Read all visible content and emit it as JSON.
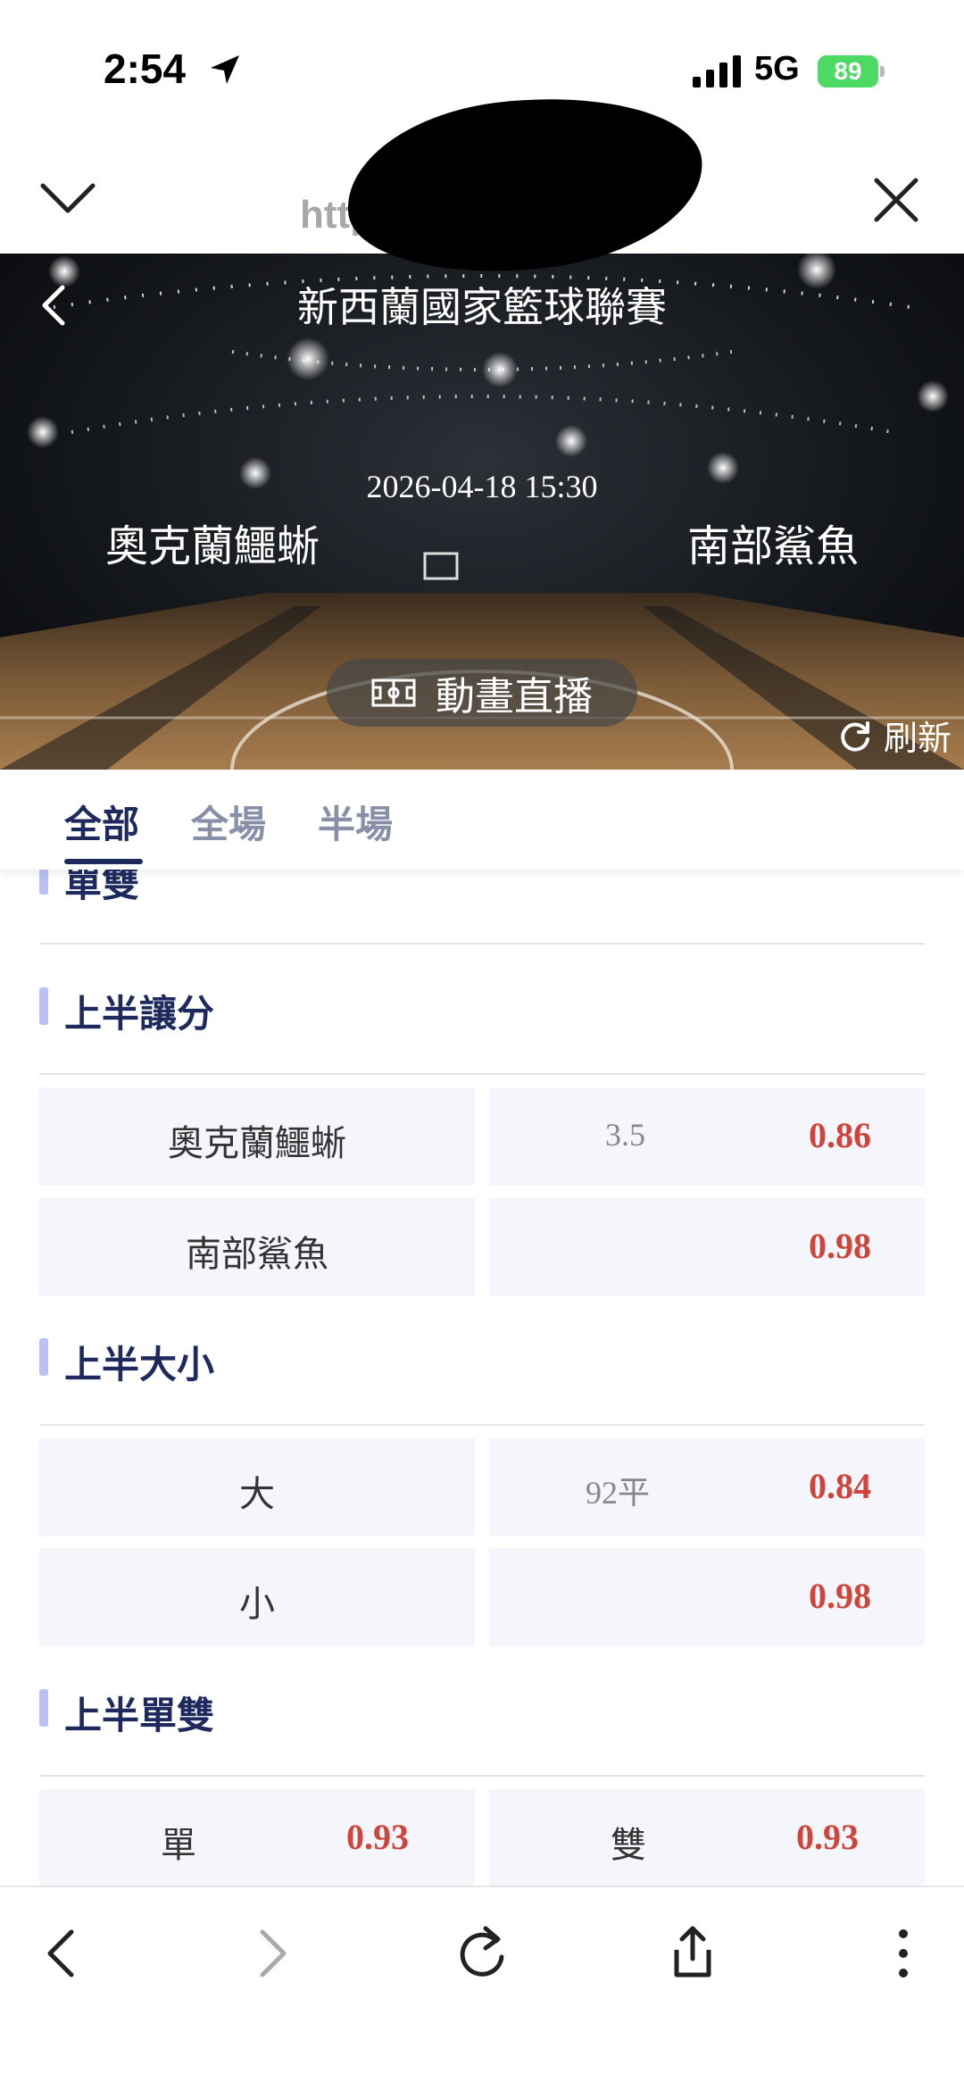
{
  "status_bar": {
    "time": "2:54",
    "network": "5G",
    "battery": "89"
  },
  "browser": {
    "url": "http:"
  },
  "match": {
    "league": "新西蘭國家籃球聯賽",
    "datetime": "2026-04-18 15:30",
    "home": "奧克蘭鱷蜥",
    "away": "南部鯊魚",
    "live_label": "動畫直播",
    "refresh_label": "刷新"
  },
  "tabs": [
    {
      "label": "全部",
      "active": true
    },
    {
      "label": "全場",
      "active": false
    },
    {
      "label": "半場",
      "active": false
    }
  ],
  "sections": {
    "partial": {
      "title": "單雙"
    },
    "first_half_handicap": {
      "title": "上半讓分",
      "rows": [
        {
          "team": "奧克蘭鱷蜥",
          "line": "3.5",
          "odds": "0.86"
        },
        {
          "team": "南部鯊魚",
          "line": "",
          "odds": "0.98"
        }
      ]
    },
    "first_half_total": {
      "title": "上半大小",
      "rows": [
        {
          "side": "大",
          "line": "92平",
          "odds": "0.84"
        },
        {
          "side": "小",
          "line": "",
          "odds": "0.98"
        }
      ]
    },
    "first_half_odd_even": {
      "title": "上半單雙",
      "items": [
        {
          "side": "單",
          "odds": "0.93"
        },
        {
          "side": "雙",
          "odds": "0.93"
        }
      ]
    }
  },
  "colors": {
    "accent": "#1e2a5e",
    "odds": "#d0453b",
    "section_bar": "#b8c1f2",
    "cell_bg": "#f4f6fb",
    "battery": "#4cd964"
  },
  "icons": [
    "location-arrow-icon",
    "signal-icon",
    "battery-icon",
    "chevron-down-icon",
    "close-icon",
    "back-icon",
    "court-icon",
    "refresh-icon",
    "nav-back-icon",
    "nav-forward-icon",
    "reload-icon",
    "share-icon",
    "more-icon"
  ]
}
